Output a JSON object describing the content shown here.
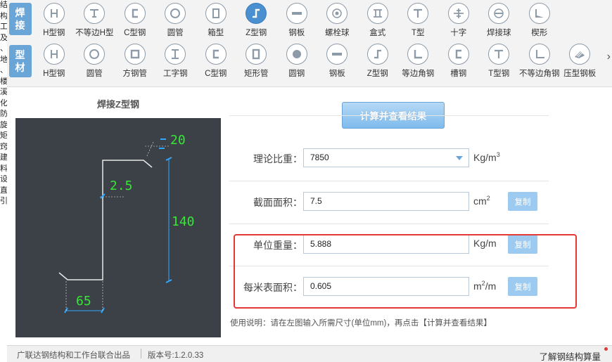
{
  "edge_text": [
    "结",
    "构",
    "工",
    "及",
    "、",
    "地",
    "、",
    "楼",
    "溪",
    "化",
    "防",
    "旋",
    "矩",
    "窍",
    "建",
    "料",
    "设",
    "直",
    "引"
  ],
  "categories": {
    "weld": "焊接",
    "profile": "型材"
  },
  "weld_tools": [
    {
      "label": "H型钢",
      "icon": "h-beam-icon"
    },
    {
      "label": "不等边H型",
      "icon": "unequal-h-icon"
    },
    {
      "label": "C型钢",
      "icon": "c-channel-icon"
    },
    {
      "label": "圆管",
      "icon": "round-pipe-icon"
    },
    {
      "label": "箱型",
      "icon": "box-section-icon"
    },
    {
      "label": "Z型钢",
      "icon": "z-section-icon",
      "active": true
    },
    {
      "label": "钢板",
      "icon": "steel-plate-icon"
    },
    {
      "label": "螺栓球",
      "icon": "bolt-ball-icon"
    },
    {
      "label": "盒式",
      "icon": "box-type-icon"
    },
    {
      "label": "T型",
      "icon": "t-section-icon"
    },
    {
      "label": "十字",
      "icon": "cross-section-icon"
    },
    {
      "label": "焊接球",
      "icon": "welded-ball-icon"
    },
    {
      "label": "楔形",
      "icon": "wedge-icon"
    }
  ],
  "profile_tools": [
    {
      "label": "H型钢",
      "icon": "h-beam-icon"
    },
    {
      "label": "圆管",
      "icon": "round-pipe-icon"
    },
    {
      "label": "方钢管",
      "icon": "square-tube-icon"
    },
    {
      "label": "工字钢",
      "icon": "i-beam-icon"
    },
    {
      "label": "C型钢",
      "icon": "c-channel-icon"
    },
    {
      "label": "矩形管",
      "icon": "rect-tube-icon"
    },
    {
      "label": "圆钢",
      "icon": "round-bar-icon"
    },
    {
      "label": "钢板",
      "icon": "steel-plate-icon"
    },
    {
      "label": "Z型钢",
      "icon": "z-section-icon"
    },
    {
      "label": "等边角钢",
      "icon": "equal-angle-icon"
    },
    {
      "label": "槽钢",
      "icon": "channel-icon"
    },
    {
      "label": "T型钢",
      "icon": "t-section-icon"
    },
    {
      "label": "不等边角钢",
      "icon": "unequal-angle-icon"
    },
    {
      "label": "压型钢板",
      "icon": "profiled-sheet-icon"
    }
  ],
  "diagram": {
    "title": "焊接Z型钢",
    "dim_top": "20",
    "dim_thickness": "2.5",
    "dim_height": "140",
    "dim_width": "65"
  },
  "calculate_label": "计算并查看结果",
  "fields": {
    "density": {
      "label": "理论比重：",
      "value": "7850",
      "unit": "Kg/m",
      "unit_sup": "3"
    },
    "area": {
      "label": "截面面积：",
      "value": "7.5",
      "unit": "cm",
      "unit_sup": "2",
      "copy": "复制"
    },
    "unit_weight": {
      "label": "单位重量：",
      "value": "5.888",
      "unit": "Kg/m",
      "unit_sup": "",
      "copy": "复制"
    },
    "surface": {
      "label": "每米表面积：",
      "value": "0.605",
      "unit": "m",
      "unit_sup": "2",
      "unit_tail": "/m",
      "copy": "复制"
    }
  },
  "note": "使用说明：请在左图输入所需尺寸(单位mm)，再点击【计算并查看结果】",
  "footer": {
    "credit": "广联达钢结构和工作台联合出品",
    "version": "版本号:1.2.0.33",
    "link": "了解钢结构算量"
  },
  "colors": {
    "accent": "#4a8fd0",
    "highlight": "#e53935",
    "diagram_bg": "#3c4047",
    "dim_text": "#37e637",
    "dim_tick": "#2ea8ff"
  }
}
